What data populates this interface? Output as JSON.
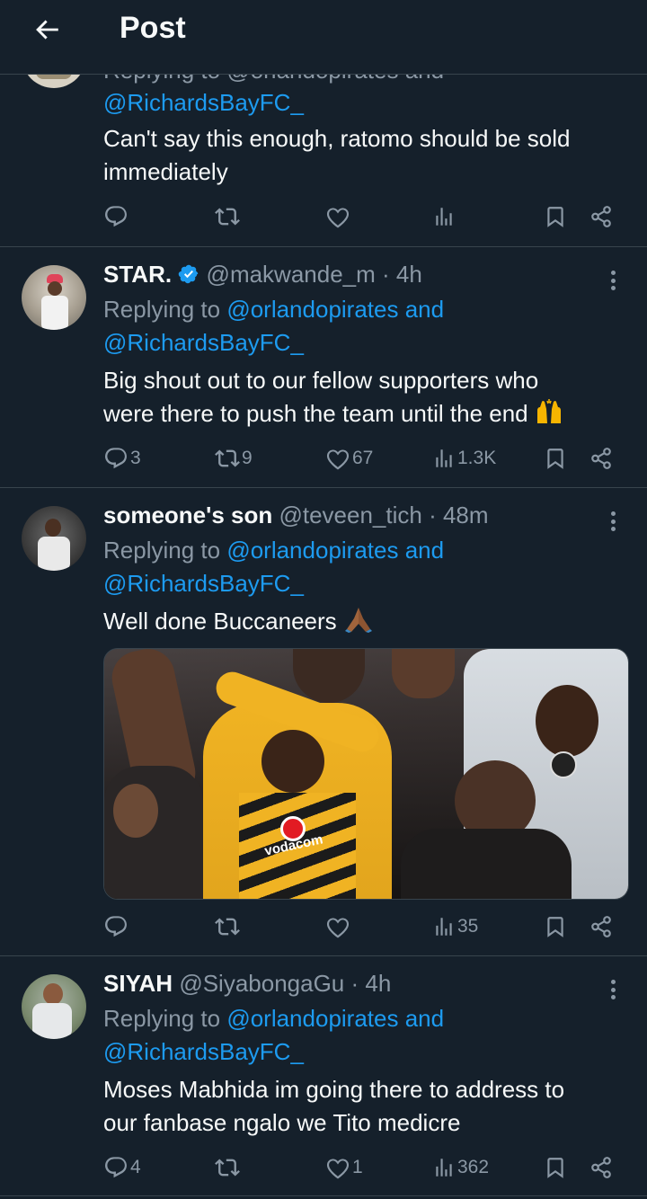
{
  "header": {
    "title": "Post"
  },
  "tweets": [
    {
      "cropped_reply": "Replying to @orlandopirates and",
      "reply_to_2": "@RichardsBayFC_",
      "text_lines": [
        "Can't say this enough, ratomo should be sold",
        "immediately"
      ],
      "stats": {
        "replies": "",
        "reposts": "",
        "likes": "",
        "views": ""
      }
    },
    {
      "name": "STAR.",
      "verified": true,
      "handle": "@makwande_m",
      "time": "· 4h",
      "replying_prefix": "Replying to",
      "reply_to_1": "@orlandopirates and",
      "reply_to_2": "@RichardsBayFC_",
      "text_lines": [
        "Big shout out to our fellow supporters who",
        "were there to push the team until the end"
      ],
      "emoji": "raising-hands",
      "stats": {
        "replies": "3",
        "reposts": "9",
        "likes": "67",
        "views": "1.3K"
      }
    },
    {
      "name": "someone's son",
      "handle": "@teveen_tich",
      "time": "· 48m",
      "replying_prefix": "Replying to",
      "reply_to_1": "@orlandopirates and",
      "reply_to_2": "@RichardsBayFC_",
      "text_lines": [
        "Well done Buccaneers"
      ],
      "emoji": "folded-hands",
      "media": {
        "jersey_text": "vodacom"
      },
      "stats": {
        "replies": "",
        "reposts": "",
        "likes": "",
        "views": "35"
      }
    },
    {
      "name": "SIYAH",
      "handle": "@SiyabongaGu",
      "time": "· 4h",
      "replying_prefix": "Replying to",
      "reply_to_1": "@orlandopirates and",
      "reply_to_2": "@RichardsBayFC_",
      "text_lines": [
        "Moses Mabhida im going there to address to",
        "our fanbase ngalo we Tito medicre"
      ],
      "stats": {
        "replies": "4",
        "reposts": "",
        "likes": "1",
        "views": "362"
      }
    }
  ],
  "icons": {
    "back": "arrow-left-icon",
    "reply": "reply-icon",
    "repost": "repost-icon",
    "like": "heart-icon",
    "views": "views-icon",
    "bookmark": "bookmark-icon",
    "share": "share-icon",
    "more": "more-icon"
  },
  "colors": {
    "background": "#15202b",
    "link": "#1d9bf0",
    "muted": "#8b98a5",
    "verified": "#1d9bf0",
    "divider": "#38444d"
  }
}
